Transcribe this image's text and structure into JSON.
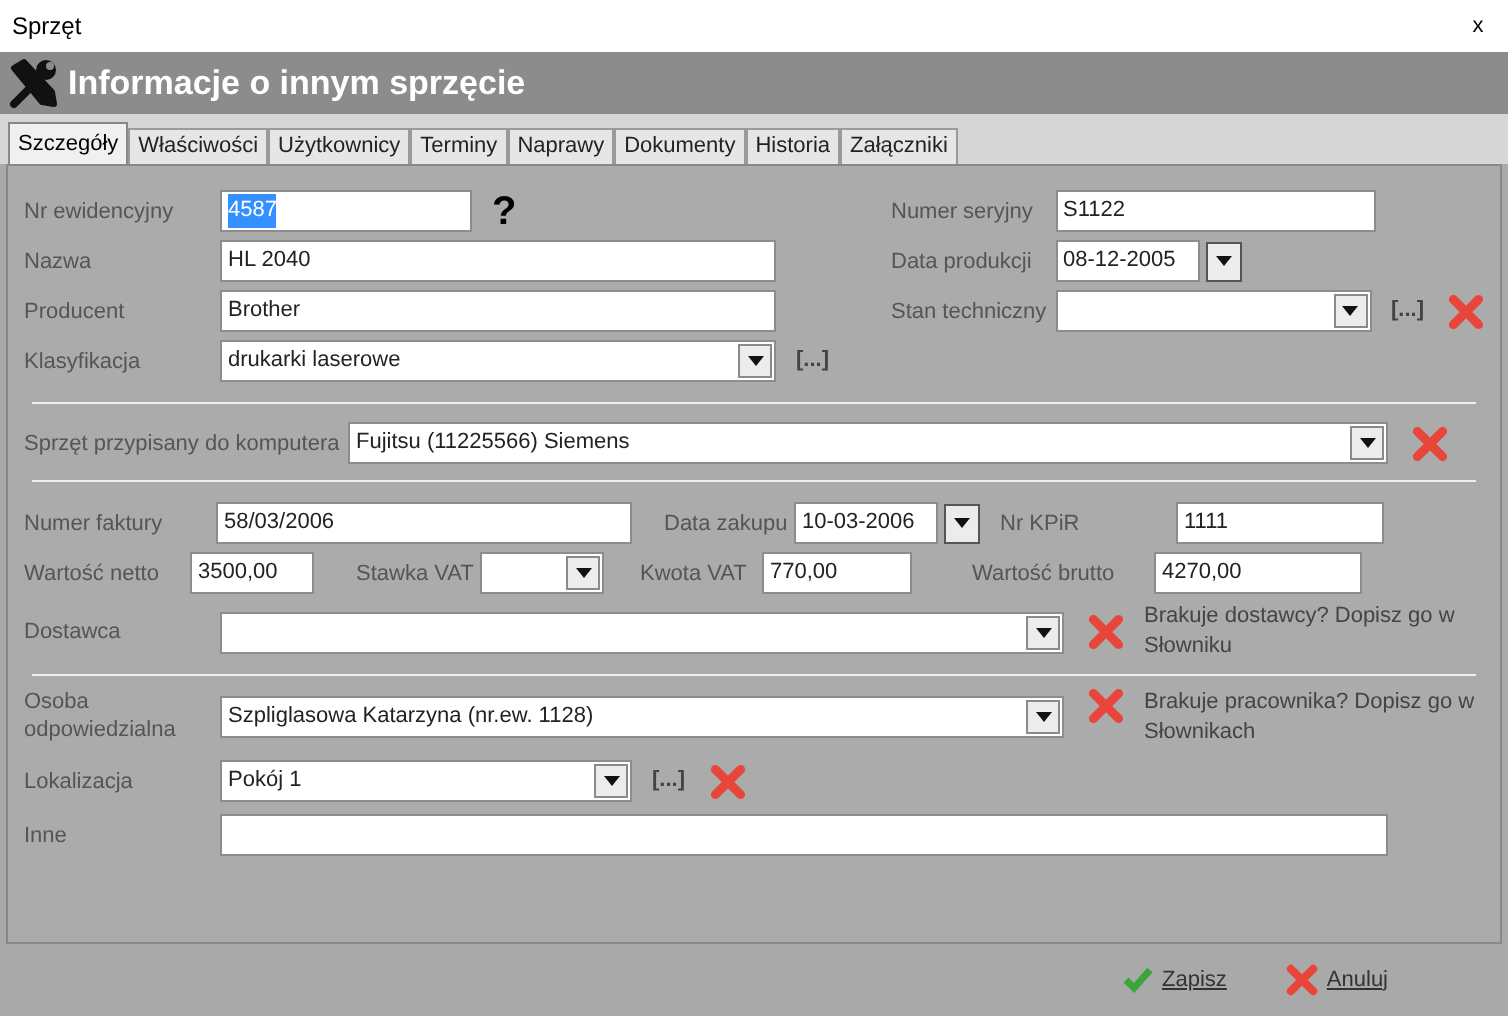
{
  "window": {
    "title": "Sprzęt",
    "close": "x"
  },
  "header": {
    "title": "Informacje o innym sprzęcie"
  },
  "tabs": [
    {
      "label": "Szczegóły",
      "selected": true
    },
    {
      "label": "Właściwości",
      "selected": false
    },
    {
      "label": "Użytkownicy",
      "selected": false
    },
    {
      "label": "Terminy",
      "selected": false
    },
    {
      "label": "Naprawy",
      "selected": false
    },
    {
      "label": "Dokumenty",
      "selected": false
    },
    {
      "label": "Historia",
      "selected": false
    },
    {
      "label": "Załączniki",
      "selected": false
    }
  ],
  "general": {
    "left": [
      {
        "label": "Nr ewidencyjny",
        "kind": "text",
        "value": "4587",
        "highlighted": true,
        "help": "?"
      },
      {
        "label": "Nazwa",
        "kind": "text",
        "value": "HL 2040"
      },
      {
        "label": "Producent",
        "kind": "text",
        "value": "Brother"
      },
      {
        "label": "Klasyfikacja",
        "kind": "select",
        "value": "drukarki laserowe",
        "browse": "[...]"
      }
    ],
    "right": [
      {
        "label": "Numer seryjny",
        "kind": "text",
        "value": "S1122"
      },
      {
        "label": "Data produkcji",
        "kind": "date",
        "value": "08-12-2005"
      },
      {
        "label": "Stan techniczny",
        "kind": "select",
        "browse": "[...]",
        "clear": true
      }
    ]
  },
  "computer": {
    "label": "Sprzęt przypisany do komputera",
    "kind": "select",
    "value": "Fujitsu (11225566) Siemens",
    "clear": true
  },
  "invoice": [
    [
      {
        "label": "Numer faktury",
        "kind": "text",
        "value": "58/03/2006"
      },
      {
        "label": "Data zakupu",
        "kind": "date",
        "value": "10-03-2006"
      },
      {
        "label": "Nr KPiR",
        "kind": "text",
        "value": "1111"
      }
    ],
    [
      {
        "label": "Wartość netto",
        "kind": "text",
        "value": "3500,00"
      },
      {
        "label": "Stawka VAT",
        "kind": "select"
      },
      {
        "label": "Kwota VAT",
        "kind": "text",
        "value": "770,00"
      },
      {
        "label": "Wartość brutto",
        "kind": "text",
        "value": "4270,00"
      }
    ],
    [
      {
        "label": "Dostawca",
        "kind": "select",
        "clear": true,
        "note": "Brakuje dostawcy? Dopisz go w Słowniku"
      }
    ]
  ],
  "person": [
    {
      "label": "Osoba odpowiedzialna",
      "kind": "select",
      "value": "Szpliglasowa Katarzyna (nr.ew. 1128)",
      "clear": true,
      "note": "Brakuje pracownika? Dopisz go w Słownikach"
    },
    {
      "label": "Lokalizacja",
      "kind": "select",
      "value": "Pokój 1",
      "browse": "[...]",
      "clear": true
    },
    {
      "label": "Inne",
      "kind": "text"
    }
  ],
  "buttons": [
    {
      "label": "Zapisz",
      "kind": "save"
    },
    {
      "label": "Anuluj",
      "kind": "cancel"
    }
  ]
}
